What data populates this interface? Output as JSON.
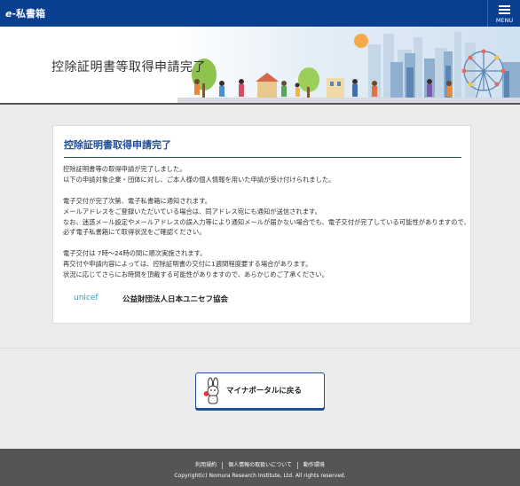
{
  "header": {
    "logo_prefix": "e",
    "logo_text": "-私書箱",
    "menu_label": "MENU"
  },
  "hero": {
    "title": "控除証明書等取得申請完了"
  },
  "card": {
    "title": "控除証明書取得申請完了",
    "para1": [
      "控除証明書等の取得申請が完了しました。",
      "以下の申請対象企業・団体に対し、ご本人様の個人情報を用いた申請が受け付けられました。"
    ],
    "para2": [
      "電子交付が完了次第、電子私書箱に通知されます。",
      "メールアドレスをご登録いただいている場合は、同アドレス宛にも通知が送信されます。",
      "なお、迷惑メール設定やメールアドレスの誤入力等により通知メールが届かない場合でも、電子交付が完了している可能性がありますので、",
      "必ず電子私書箱にて取得状況をご確認ください。"
    ],
    "para3": [
      "電子交付は 7時〜24時の間に順次実施されます。",
      "再交付や申請内容によっては、控除証明書の交付に1週間程度要する場合があります。",
      "状況に応じてさらにお時間を頂戴する可能性がありますので、あらかじめご了承ください。"
    ],
    "org_logo": "unicef",
    "org_name": "公益財団法人日本ユニセフ協会"
  },
  "portal_button": {
    "label": "マイナポータルに戻る"
  },
  "footer": {
    "links": [
      "利用規約",
      "個人情報の取扱いについて",
      "動作環境"
    ],
    "copyright": "Copyright(c) Nomura Research Institute, Ltd. All rights reserved."
  },
  "colors": {
    "header_bg": "#0a3f8f",
    "accent": "#1f4e96",
    "footer_bg": "#555555",
    "unicef": "#1ca0de"
  }
}
